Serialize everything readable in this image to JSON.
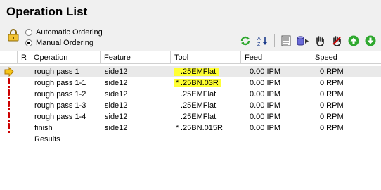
{
  "panel": {
    "title": "Operation List",
    "ordering": {
      "automatic_label": "Automatic Ordering",
      "manual_label": "Manual Ordering",
      "selected": "manual"
    }
  },
  "colors": {
    "highlight": "#ffff33",
    "selected_row": "#e9e9e9",
    "warning_red": "#cc0000",
    "arrow_yellow": "#f5c518",
    "go_green": "#2fa82f"
  },
  "toolbar": {
    "icons": [
      "regenerate-icon",
      "sort-icon",
      "list-icon",
      "stock-play-icon",
      "hand-icon",
      "hand-stop-icon",
      "move-up-icon",
      "move-down-icon"
    ]
  },
  "columns": {
    "r": "R",
    "operation": "Operation",
    "feature": "Feature",
    "tool": "Tool",
    "feed": "Feed",
    "speed": "Speed"
  },
  "rows": [
    {
      "status": "current",
      "operation": "rough pass 1",
      "feature": "side12",
      "tool": ".25EMFlat",
      "tool_mark": "",
      "feed": "0.00 IPM",
      "speed": "0 RPM",
      "highlight": true
    },
    {
      "status": "warning",
      "operation": "rough pass 1-1",
      "feature": "side12",
      "tool": ".25BN.03R",
      "tool_mark": "*",
      "feed": "0.00 IPM",
      "speed": "0 RPM",
      "highlight": true
    },
    {
      "status": "warning",
      "operation": "rough pass 1-2",
      "feature": "side12",
      "tool": ".25EMFlat",
      "tool_mark": "",
      "feed": "0.00 IPM",
      "speed": "0 RPM",
      "highlight": false
    },
    {
      "status": "warning",
      "operation": "rough pass 1-3",
      "feature": "side12",
      "tool": ".25EMFlat",
      "tool_mark": "",
      "feed": "0.00 IPM",
      "speed": "0 RPM",
      "highlight": false
    },
    {
      "status": "warning",
      "operation": "rough pass 1-4",
      "feature": "side12",
      "tool": ".25EMFlat",
      "tool_mark": "",
      "feed": "0.00 IPM",
      "speed": "0 RPM",
      "highlight": false
    },
    {
      "status": "warning",
      "operation": "finish",
      "feature": "side12",
      "tool": ".25BN.015R",
      "tool_mark": "*",
      "feed": "0.00 IPM",
      "speed": "0 RPM",
      "highlight": false
    }
  ],
  "results_label": "Results"
}
